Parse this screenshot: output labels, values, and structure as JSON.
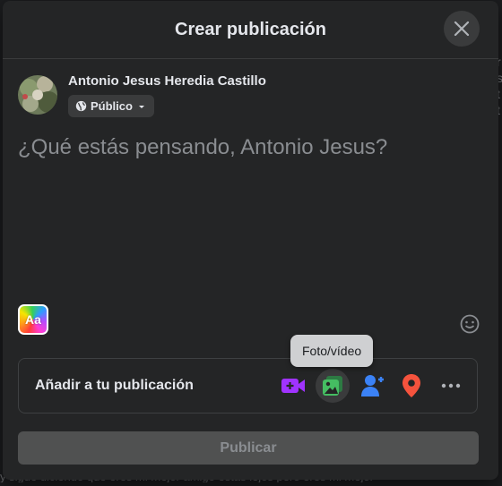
{
  "background": {
    "right_edge_text": "r\ns\nt\nt",
    "bottom_text": "y sigue diciendo que eres mi mejor amigo estás lejos pero eres mi mejor"
  },
  "dialog": {
    "title": "Crear publicación",
    "close_icon": "close-icon"
  },
  "user": {
    "name": "Antonio Jesus Heredia Castillo",
    "audience": "Público",
    "audience_icon": "globe-icon"
  },
  "composer": {
    "placeholder": "¿Qué estás pensando, Antonio Jesus?"
  },
  "text_style_button": {
    "label": "Aa"
  },
  "add_to_post": {
    "label": "Añadir a tu publicación",
    "tools": [
      {
        "name": "live-video",
        "icon": "video-camera-plus-icon",
        "color": "#a033ff"
      },
      {
        "name": "photo-video",
        "icon": "photo-icon",
        "color": "#45bd62"
      },
      {
        "name": "tag-people",
        "icon": "tag-user-icon",
        "color": "#1877f2"
      },
      {
        "name": "check-in",
        "icon": "location-pin-icon",
        "color": "#f5533d"
      },
      {
        "name": "more",
        "icon": "more-dots-icon",
        "color": "#b0b3b8"
      }
    ]
  },
  "tooltip": {
    "text": "Foto/vídeo"
  },
  "publish_button": {
    "label": "Publicar"
  },
  "colors": {
    "modal_bg": "#242526",
    "overlay_bg": "#18191a",
    "text_primary": "#e4e6eb",
    "text_placeholder": "#8a8d91",
    "publish_disabled_bg": "#505151"
  }
}
